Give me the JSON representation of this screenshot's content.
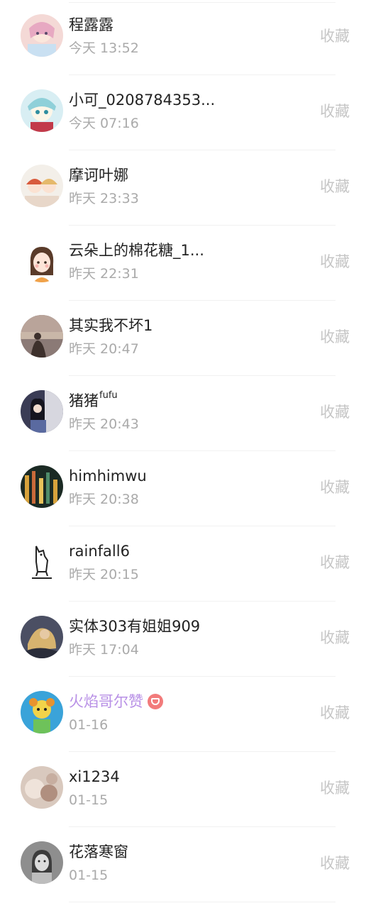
{
  "list": {
    "items": [
      {
        "name": "程露露",
        "sup": "",
        "time": "今天 13:52",
        "action": "收藏",
        "vip": false,
        "avatar_bg": "#f4d9d6",
        "avatar_fg": "#e7a9c2",
        "avatar_icon": "anime-girl-icon"
      },
      {
        "name": "小可_0208784353...",
        "sup": "",
        "time": "今天 07:16",
        "action": "收藏",
        "vip": false,
        "avatar_bg": "#d8eef3",
        "avatar_fg": "#8fd0d9",
        "avatar_icon": "anime-character-icon"
      },
      {
        "name": "摩诃叶娜",
        "sup": "",
        "time": "昨天 23:33",
        "action": "收藏",
        "vip": false,
        "avatar_bg": "#f3efe9",
        "avatar_fg": "#e5b96c",
        "avatar_icon": "anime-couple-icon"
      },
      {
        "name": "云朵上的棉花糖_1...",
        "sup": "",
        "time": "昨天 22:31",
        "action": "收藏",
        "vip": false,
        "avatar_bg": "#ffffff",
        "avatar_fg": "#5a3b2a",
        "avatar_icon": "cartoon-girl-icon"
      },
      {
        "name": "其实我不坏1",
        "sup": "",
        "time": "昨天 20:47",
        "action": "收藏",
        "vip": false,
        "avatar_bg": "#8b7a76",
        "avatar_fg": "#c9b7a8",
        "avatar_icon": "person-silhouette-icon"
      },
      {
        "name": "猪猪",
        "sup": "fufu",
        "time": "昨天 20:43",
        "action": "收藏",
        "vip": false,
        "avatar_bg": "#3a3c55",
        "avatar_fg": "#d7d7df",
        "avatar_icon": "girl-photo-icon"
      },
      {
        "name": "himhimwu",
        "sup": "",
        "time": "昨天 20:38",
        "action": "收藏",
        "vip": false,
        "avatar_bg": "#1b2a24",
        "avatar_fg": "#d7a23c",
        "avatar_icon": "city-lights-icon"
      },
      {
        "name": "rainfall6",
        "sup": "",
        "time": "昨天 20:15",
        "action": "收藏",
        "vip": false,
        "avatar_bg": "#ffffff",
        "avatar_fg": "#222222",
        "avatar_icon": "dogcat-logo-icon"
      },
      {
        "name": "实体303有姐姐909",
        "sup": "",
        "time": "昨天 17:04",
        "action": "收藏",
        "vip": false,
        "avatar_bg": "#4b4f63",
        "avatar_fg": "#d7b36f",
        "avatar_icon": "game-hero-icon"
      },
      {
        "name": "火焰哥尔赞",
        "sup": "",
        "time": "01-16",
        "action": "收藏",
        "vip": true,
        "avatar_bg": "#3aa3d9",
        "avatar_fg": "#f1d34a",
        "avatar_icon": "cartoon-dog-icon"
      },
      {
        "name": "xi1234",
        "sup": "",
        "time": "01-15",
        "action": "收藏",
        "vip": false,
        "avatar_bg": "#d9c9be",
        "avatar_fg": "#b08f7f",
        "avatar_icon": "blurred-photo-icon"
      },
      {
        "name": "花落寒窗",
        "sup": "",
        "time": "01-15",
        "action": "收藏",
        "vip": false,
        "avatar_bg": "#8e8e8e",
        "avatar_fg": "#3c3c3c",
        "avatar_icon": "child-photo-icon"
      }
    ]
  }
}
